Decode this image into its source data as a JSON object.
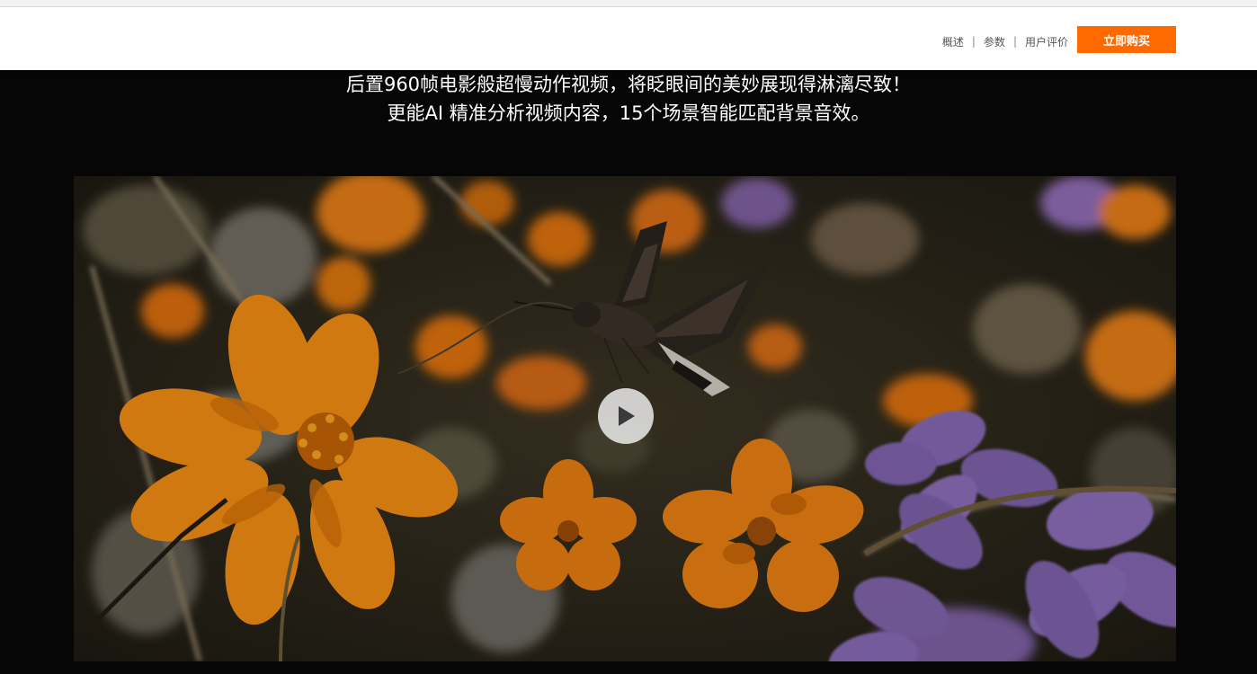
{
  "nav": {
    "links": [
      {
        "label": "概述"
      },
      {
        "label": "参数"
      },
      {
        "label": "用户评价"
      }
    ],
    "separator": "|",
    "buy_label": "立即购买",
    "accent": "#ff6a00"
  },
  "headline": {
    "line1": "后置960帧电影般超慢动作视频，将眨眼间的美妙展现得淋漓尽致！",
    "line2": "更能AI 精准分析视频内容，15个场景智能匹配背景音效。"
  },
  "video": {
    "play_icon": "play-icon"
  }
}
